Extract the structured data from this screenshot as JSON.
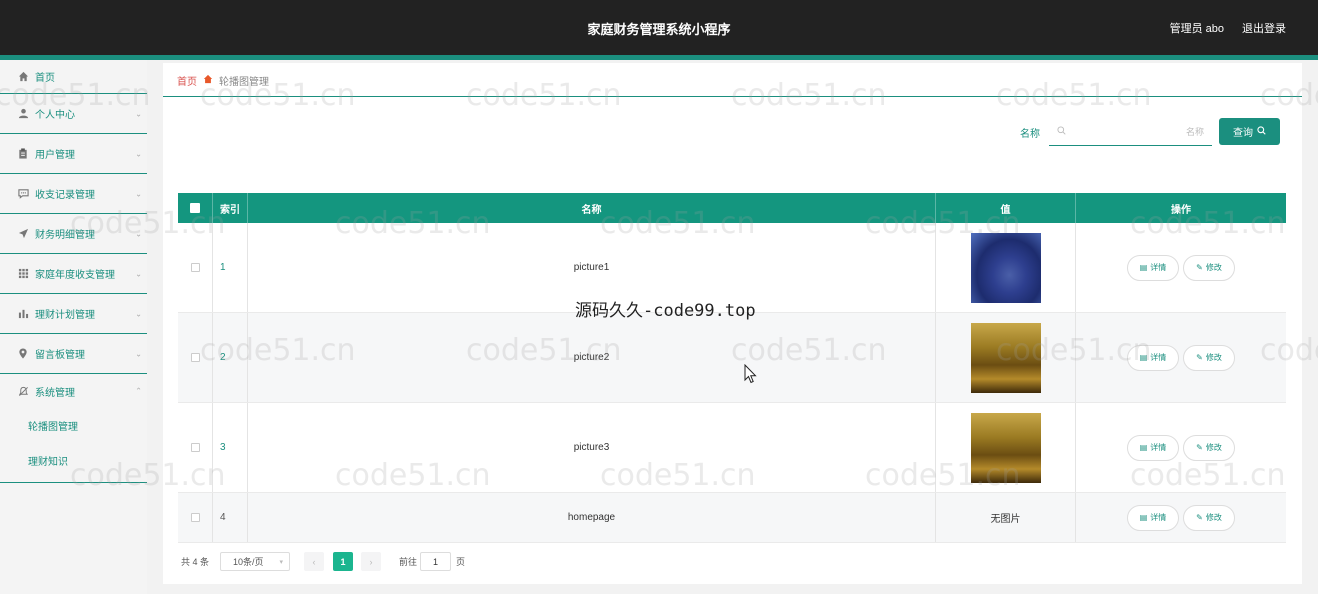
{
  "header": {
    "app_title": "家庭财务管理系统小程序",
    "user": "管理员 abo",
    "logout": "退出登录"
  },
  "sidebar": {
    "items": [
      {
        "label": "首页",
        "icon": "home-icon"
      },
      {
        "label": "个人中心",
        "icon": "user-icon"
      },
      {
        "label": "用户管理",
        "icon": "clipboard-icon"
      },
      {
        "label": "收支记录管理",
        "icon": "chat-icon"
      },
      {
        "label": "财务明细管理",
        "icon": "send-icon"
      },
      {
        "label": "家庭年度收支管理",
        "icon": "grid-icon"
      },
      {
        "label": "理财计划管理",
        "icon": "bar-chart-icon"
      },
      {
        "label": "留言板管理",
        "icon": "location-icon"
      },
      {
        "label": "系统管理",
        "icon": "no-bell-icon"
      }
    ],
    "sub_items": [
      "轮播图管理",
      "理财知识"
    ]
  },
  "breadcrumb": {
    "home": "首页",
    "current": "轮播图管理"
  },
  "search": {
    "label": "名称",
    "placeholder": "名称",
    "button": "查询"
  },
  "table": {
    "headers": {
      "index": "索引",
      "name": "名称",
      "value": "值",
      "ops": "操作"
    },
    "rows": [
      {
        "index": "1",
        "name": "picture1",
        "value": "",
        "thumb": "blue"
      },
      {
        "index": "2",
        "name": "picture2",
        "value": "",
        "thumb": "gold"
      },
      {
        "index": "3",
        "name": "picture3",
        "value": "",
        "thumb": "gold"
      },
      {
        "index": "4",
        "name": "homepage",
        "value": "无图片",
        "thumb": "none"
      }
    ],
    "detail_label": "详情",
    "edit_label": "修改"
  },
  "pagination": {
    "total": "共 4 条",
    "page_size": "10条/页",
    "current_page": "1",
    "goto_label": "前往",
    "goto_value": "1",
    "page_suffix": "页"
  },
  "watermark": {
    "text": "code51.cn",
    "center": "源码久久-code99.top"
  },
  "colors": {
    "accent": "#1b8f7f",
    "header_bg": "#222222",
    "table_header": "#14967f"
  }
}
